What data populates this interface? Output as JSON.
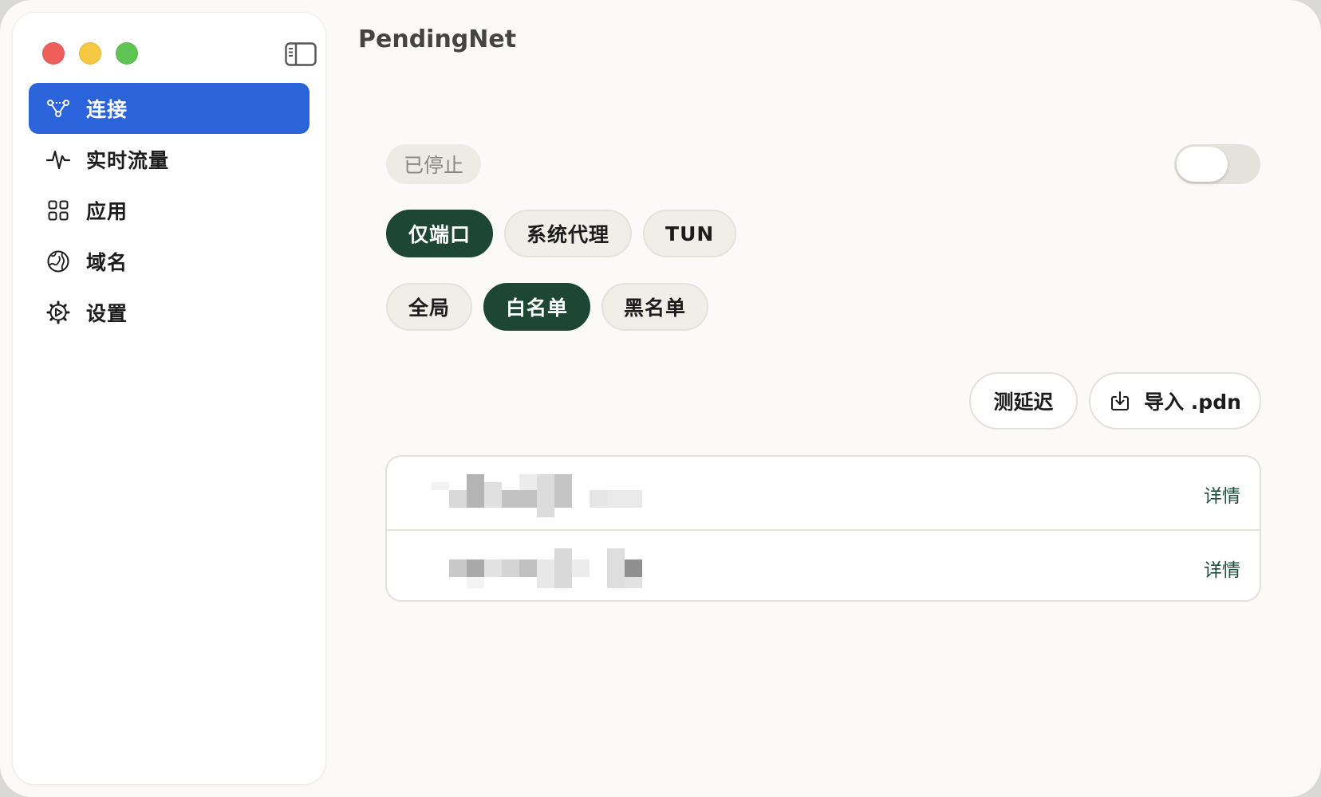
{
  "app": {
    "title": "PendingNet"
  },
  "sidebar": {
    "items": [
      {
        "label": "连接",
        "icon": "nodes-icon",
        "active": true
      },
      {
        "label": "实时流量",
        "icon": "pulse-icon",
        "active": false
      },
      {
        "label": "应用",
        "icon": "grid-icon",
        "active": false
      },
      {
        "label": "域名",
        "icon": "globe-icon",
        "active": false
      },
      {
        "label": "设置",
        "icon": "gear-icon",
        "active": false
      }
    ]
  },
  "connection": {
    "status": "已停止",
    "enabled": false,
    "modes": [
      "仅端口",
      "系统代理",
      "TUN"
    ],
    "selected_mode": "仅端口",
    "routing": [
      "全局",
      "白名单",
      "黑名单"
    ],
    "selected_routing": "白名单"
  },
  "actions": {
    "latency_label": "测延迟",
    "import_label": "导入 .pdn"
  },
  "servers": {
    "rows": [
      {
        "name_redacted": true,
        "detail_label": "详情"
      },
      {
        "name_redacted": true,
        "detail_label": "详情"
      }
    ]
  },
  "colors": {
    "accent_blue": "#2b63da",
    "selected_green": "#1d4634",
    "detail_green": "#1f4f3a"
  }
}
